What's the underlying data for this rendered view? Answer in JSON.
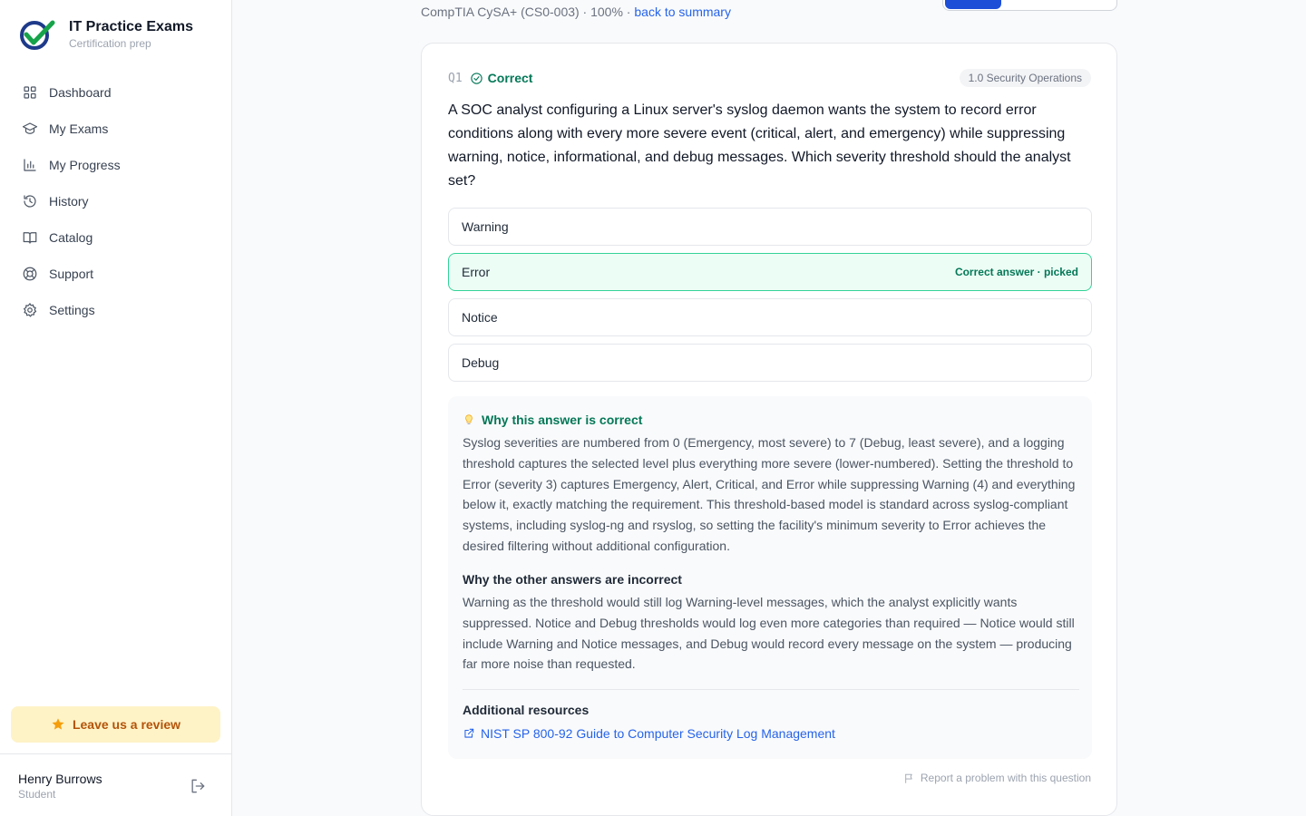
{
  "brand": {
    "title": "IT Practice Exams",
    "subtitle": "Certification prep",
    "logo_icon": "check-badge-logo"
  },
  "sidebar": {
    "items": [
      {
        "label": "Dashboard",
        "icon": "grid-icon"
      },
      {
        "label": "My Exams",
        "icon": "graduation-cap-icon"
      },
      {
        "label": "My Progress",
        "icon": "bar-chart-icon"
      },
      {
        "label": "History",
        "icon": "history-icon"
      },
      {
        "label": "Catalog",
        "icon": "book-open-icon"
      },
      {
        "label": "Support",
        "icon": "life-buoy-icon"
      },
      {
        "label": "Settings",
        "icon": "gear-icon"
      }
    ],
    "review_label": "Leave us a review",
    "user": {
      "name": "Henry Burrows",
      "role": "Student"
    }
  },
  "header": {
    "exam_info": "CompTIA CySA+ (CS0-003) · 100% · ",
    "back_link": "back to summary"
  },
  "question": {
    "number": "Q1",
    "status": "Correct",
    "domain": "1.0 Security Operations",
    "text": "A SOC analyst configuring a Linux server's syslog daemon wants the system to record error conditions along with every more severe event (critical, alert, and emergency) while suppressing warning, notice, informational, and debug messages. Which severity threshold should the analyst set?",
    "options": [
      {
        "label": "Warning"
      },
      {
        "label": "Error",
        "tag": "Correct answer · picked"
      },
      {
        "label": "Notice"
      },
      {
        "label": "Debug"
      }
    ]
  },
  "explanation": {
    "correct_heading": "Why this answer is correct",
    "correct_text": "Syslog severities are numbered from 0 (Emergency, most severe) to 7 (Debug, least severe), and a logging threshold captures the selected level plus everything more severe (lower-numbered). Setting the threshold to Error (severity 3) captures Emergency, Alert, Critical, and Error while suppressing Warning (4) and everything below it, exactly matching the requirement. This threshold-based model is standard across syslog-compliant systems, including syslog-ng and rsyslog, so setting the facility's minimum severity to Error achieves the desired filtering without additional configuration.",
    "incorrect_heading": "Why the other answers are incorrect",
    "incorrect_text": "Warning as the threshold would still log Warning-level messages, which the analyst explicitly wants suppressed. Notice and Debug thresholds would log even more categories than required — Notice would still include Warning and Notice messages, and Debug would record every message on the system — producing far more noise than requested.",
    "resources_heading": "Additional resources",
    "resource_link": "NIST SP 800-92 Guide to Computer Security Log Management"
  },
  "report_label": "Report a problem with this question",
  "colors": {
    "accent": "#2563eb",
    "success": "#047857",
    "review_bg": "#fef3c7",
    "review_text": "#b45309"
  }
}
